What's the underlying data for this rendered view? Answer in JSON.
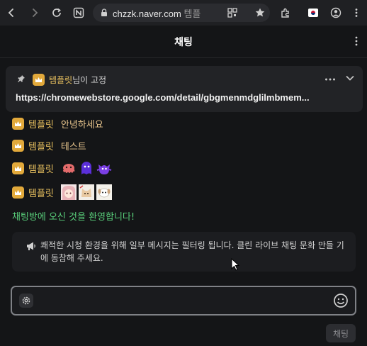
{
  "browser": {
    "url_host": "chzzk.naver.com",
    "url_tail": "템플"
  },
  "chat": {
    "title": "채팅"
  },
  "pinned": {
    "nickname": "템플릿",
    "label": "님이 고정",
    "url_text": "https://chromewebstore.google.com/detail/gbgmenmdglilmbmem..."
  },
  "messages": [
    {
      "nickname": "템플릿",
      "text": "안녕하세요"
    },
    {
      "nickname": "템플릿",
      "text": "테스트"
    },
    {
      "nickname": "템플릿",
      "emotes": [
        "octopus-emote",
        "purple-blob-emote",
        "purple-ghost-emote"
      ]
    },
    {
      "nickname": "템플릿",
      "emotes": [
        "anime-girl-emote",
        "cat-emote",
        "puppy-emote"
      ]
    }
  ],
  "welcome": "채팅방에 오신 것을 환영합니다!",
  "notice": "쾌적한 시청 환경을 위해 일부 메시지는 필터링 됩니다. 클린 라이브 채팅 문화 만들 기에 동참해 주세요.",
  "input": {
    "placeholder": ""
  },
  "send": {
    "label": "채팅"
  },
  "colors": {
    "nickname": "#e9c15f",
    "badge": "#e2a93b",
    "welcome": "#5ad17c",
    "background": "#141517"
  }
}
